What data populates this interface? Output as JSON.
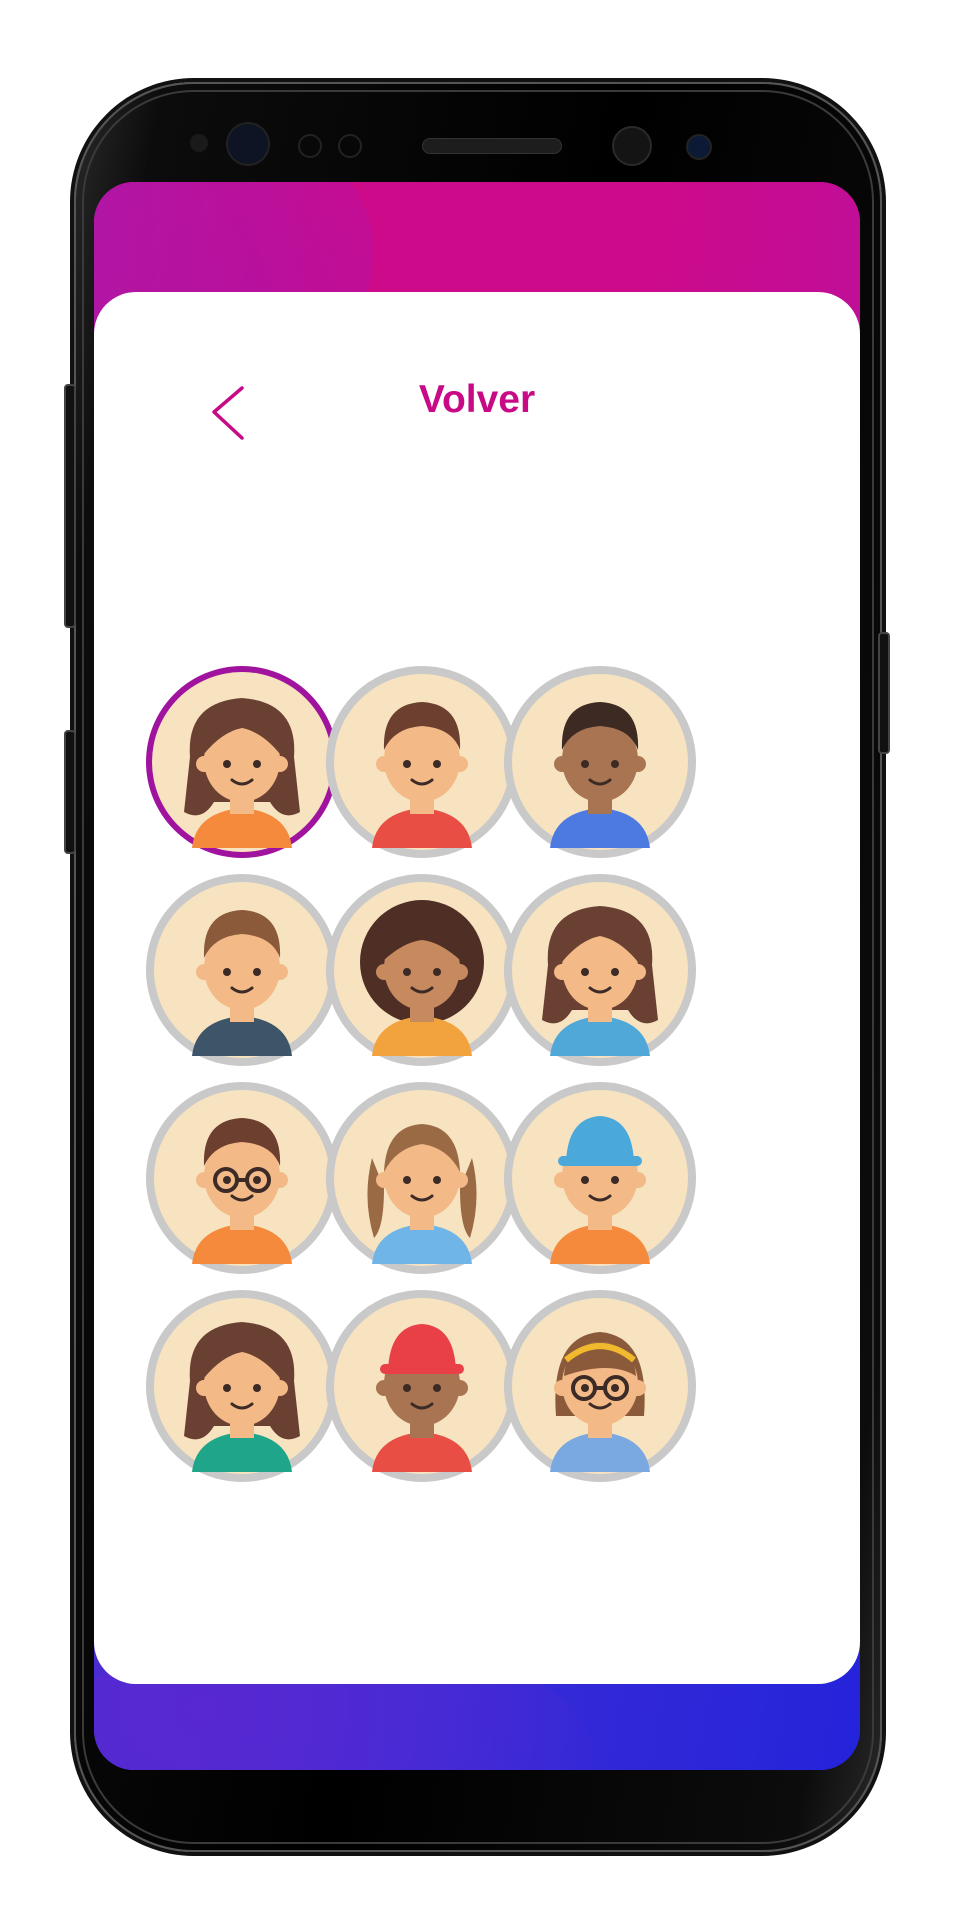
{
  "header": {
    "title": "Volver",
    "back_icon": "chevron-left-icon"
  },
  "colors": {
    "accent": "#c80a87",
    "selected_ring": "#a0139f",
    "ring": "#c9c9c9",
    "bg": "#f7e3bf"
  },
  "avatars": [
    {
      "name": "girl-long-brown-hair",
      "selected": true
    },
    {
      "name": "boy-red-shirt",
      "selected": false
    },
    {
      "name": "boy-dark-skin-blue-shirt",
      "selected": false
    },
    {
      "name": "boy-dark-blue-shirt",
      "selected": false
    },
    {
      "name": "girl-curly-hair",
      "selected": false
    },
    {
      "name": "girl-blue-shirt",
      "selected": false
    },
    {
      "name": "boy-glasses",
      "selected": false
    },
    {
      "name": "girl-pigtails",
      "selected": false
    },
    {
      "name": "boy-blue-cap",
      "selected": false
    },
    {
      "name": "girl-green-shirt",
      "selected": false
    },
    {
      "name": "boy-red-cap",
      "selected": false
    },
    {
      "name": "girl-glasses-headband",
      "selected": false
    }
  ]
}
